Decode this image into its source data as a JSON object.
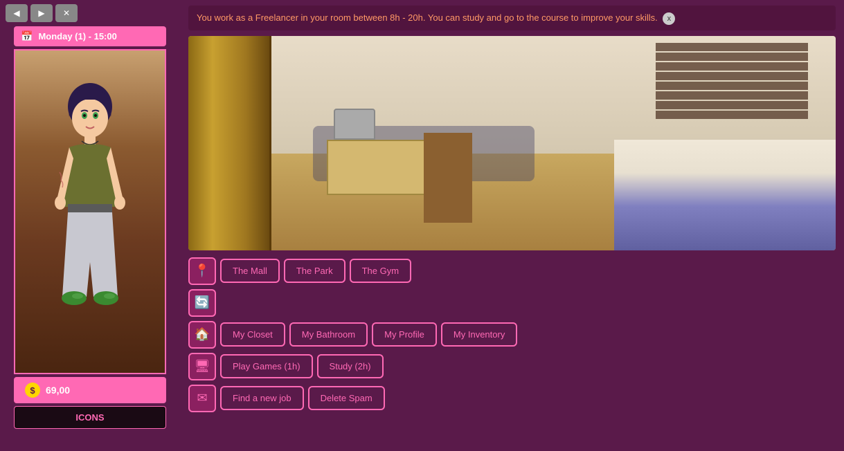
{
  "leftPanel": {
    "navButtons": [
      {
        "label": "◀",
        "name": "back"
      },
      {
        "label": "▶",
        "name": "forward"
      },
      {
        "label": "✕",
        "name": "close"
      }
    ],
    "dateBar": {
      "label": "Monday (1) - 15:00"
    },
    "money": "69,00",
    "iconsLabel": "ICONS"
  },
  "rightPanel": {
    "infoBanner": "You work as a Freelancer in your room between 8h - 20h. You can study and go to the course to improve your skills.",
    "locationRow": {
      "places": [
        "The Mall",
        "The Park",
        "The Gym"
      ]
    },
    "homeRow": {
      "places": [
        "My Closet",
        "My Bathroom",
        "My Profile",
        "My Inventory"
      ]
    },
    "computerRow": {
      "actions": [
        "Play Games (1h)",
        "Study (2h)"
      ]
    },
    "mailRow": {
      "actions": [
        "Find a new job",
        "Delete Spam"
      ]
    }
  }
}
